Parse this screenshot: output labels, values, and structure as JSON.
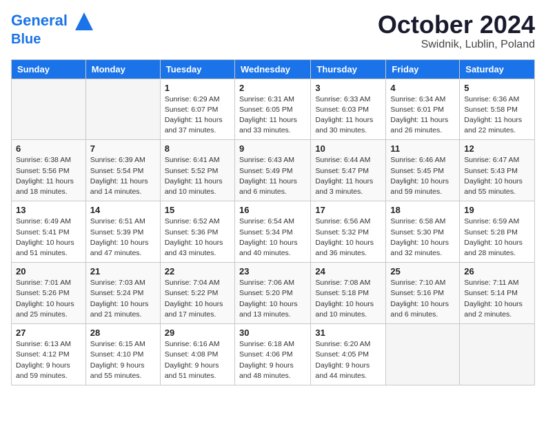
{
  "header": {
    "logo_line1": "General",
    "logo_line2": "Blue",
    "month": "October 2024",
    "location": "Swidnik, Lublin, Poland"
  },
  "weekdays": [
    "Sunday",
    "Monday",
    "Tuesday",
    "Wednesday",
    "Thursday",
    "Friday",
    "Saturday"
  ],
  "weeks": [
    [
      {
        "day": "",
        "detail": ""
      },
      {
        "day": "",
        "detail": ""
      },
      {
        "day": "1",
        "detail": "Sunrise: 6:29 AM\nSunset: 6:07 PM\nDaylight: 11 hours\nand 37 minutes."
      },
      {
        "day": "2",
        "detail": "Sunrise: 6:31 AM\nSunset: 6:05 PM\nDaylight: 11 hours\nand 33 minutes."
      },
      {
        "day": "3",
        "detail": "Sunrise: 6:33 AM\nSunset: 6:03 PM\nDaylight: 11 hours\nand 30 minutes."
      },
      {
        "day": "4",
        "detail": "Sunrise: 6:34 AM\nSunset: 6:01 PM\nDaylight: 11 hours\nand 26 minutes."
      },
      {
        "day": "5",
        "detail": "Sunrise: 6:36 AM\nSunset: 5:58 PM\nDaylight: 11 hours\nand 22 minutes."
      }
    ],
    [
      {
        "day": "6",
        "detail": "Sunrise: 6:38 AM\nSunset: 5:56 PM\nDaylight: 11 hours\nand 18 minutes."
      },
      {
        "day": "7",
        "detail": "Sunrise: 6:39 AM\nSunset: 5:54 PM\nDaylight: 11 hours\nand 14 minutes."
      },
      {
        "day": "8",
        "detail": "Sunrise: 6:41 AM\nSunset: 5:52 PM\nDaylight: 11 hours\nand 10 minutes."
      },
      {
        "day": "9",
        "detail": "Sunrise: 6:43 AM\nSunset: 5:49 PM\nDaylight: 11 hours\nand 6 minutes."
      },
      {
        "day": "10",
        "detail": "Sunrise: 6:44 AM\nSunset: 5:47 PM\nDaylight: 11 hours\nand 3 minutes."
      },
      {
        "day": "11",
        "detail": "Sunrise: 6:46 AM\nSunset: 5:45 PM\nDaylight: 10 hours\nand 59 minutes."
      },
      {
        "day": "12",
        "detail": "Sunrise: 6:47 AM\nSunset: 5:43 PM\nDaylight: 10 hours\nand 55 minutes."
      }
    ],
    [
      {
        "day": "13",
        "detail": "Sunrise: 6:49 AM\nSunset: 5:41 PM\nDaylight: 10 hours\nand 51 minutes."
      },
      {
        "day": "14",
        "detail": "Sunrise: 6:51 AM\nSunset: 5:39 PM\nDaylight: 10 hours\nand 47 minutes."
      },
      {
        "day": "15",
        "detail": "Sunrise: 6:52 AM\nSunset: 5:36 PM\nDaylight: 10 hours\nand 43 minutes."
      },
      {
        "day": "16",
        "detail": "Sunrise: 6:54 AM\nSunset: 5:34 PM\nDaylight: 10 hours\nand 40 minutes."
      },
      {
        "day": "17",
        "detail": "Sunrise: 6:56 AM\nSunset: 5:32 PM\nDaylight: 10 hours\nand 36 minutes."
      },
      {
        "day": "18",
        "detail": "Sunrise: 6:58 AM\nSunset: 5:30 PM\nDaylight: 10 hours\nand 32 minutes."
      },
      {
        "day": "19",
        "detail": "Sunrise: 6:59 AM\nSunset: 5:28 PM\nDaylight: 10 hours\nand 28 minutes."
      }
    ],
    [
      {
        "day": "20",
        "detail": "Sunrise: 7:01 AM\nSunset: 5:26 PM\nDaylight: 10 hours\nand 25 minutes."
      },
      {
        "day": "21",
        "detail": "Sunrise: 7:03 AM\nSunset: 5:24 PM\nDaylight: 10 hours\nand 21 minutes."
      },
      {
        "day": "22",
        "detail": "Sunrise: 7:04 AM\nSunset: 5:22 PM\nDaylight: 10 hours\nand 17 minutes."
      },
      {
        "day": "23",
        "detail": "Sunrise: 7:06 AM\nSunset: 5:20 PM\nDaylight: 10 hours\nand 13 minutes."
      },
      {
        "day": "24",
        "detail": "Sunrise: 7:08 AM\nSunset: 5:18 PM\nDaylight: 10 hours\nand 10 minutes."
      },
      {
        "day": "25",
        "detail": "Sunrise: 7:10 AM\nSunset: 5:16 PM\nDaylight: 10 hours\nand 6 minutes."
      },
      {
        "day": "26",
        "detail": "Sunrise: 7:11 AM\nSunset: 5:14 PM\nDaylight: 10 hours\nand 2 minutes."
      }
    ],
    [
      {
        "day": "27",
        "detail": "Sunrise: 6:13 AM\nSunset: 4:12 PM\nDaylight: 9 hours\nand 59 minutes."
      },
      {
        "day": "28",
        "detail": "Sunrise: 6:15 AM\nSunset: 4:10 PM\nDaylight: 9 hours\nand 55 minutes."
      },
      {
        "day": "29",
        "detail": "Sunrise: 6:16 AM\nSunset: 4:08 PM\nDaylight: 9 hours\nand 51 minutes."
      },
      {
        "day": "30",
        "detail": "Sunrise: 6:18 AM\nSunset: 4:06 PM\nDaylight: 9 hours\nand 48 minutes."
      },
      {
        "day": "31",
        "detail": "Sunrise: 6:20 AM\nSunset: 4:05 PM\nDaylight: 9 hours\nand 44 minutes."
      },
      {
        "day": "",
        "detail": ""
      },
      {
        "day": "",
        "detail": ""
      }
    ]
  ]
}
